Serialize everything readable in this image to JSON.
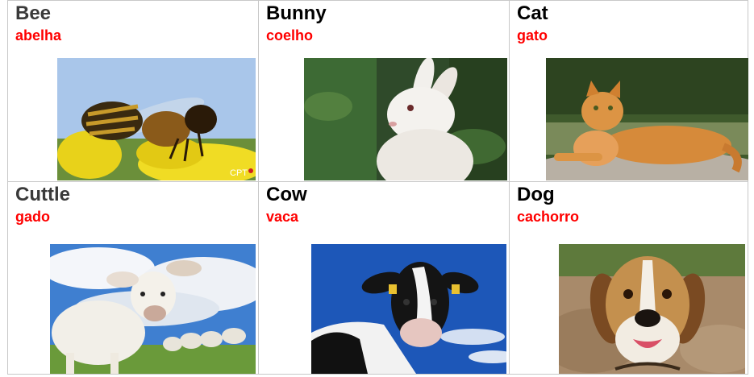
{
  "cards": [
    {
      "english": "Bee",
      "portuguese": "abelha",
      "english_color": "#3a3a3a",
      "image": "bee-photo",
      "watermark": "CPT"
    },
    {
      "english": "Bunny",
      "portuguese": "coelho",
      "english_color": "#000000",
      "image": "bunny-photo"
    },
    {
      "english": "Cat",
      "portuguese": "gato",
      "english_color": "#000000",
      "image": "cat-photo"
    },
    {
      "english": "Cuttle",
      "portuguese": "gado",
      "english_color": "#3a3a3a",
      "image": "cattle-photo"
    },
    {
      "english": "Cow",
      "portuguese": "vaca",
      "english_color": "#000000",
      "image": "cow-photo"
    },
    {
      "english": "Dog",
      "portuguese": "cachorro",
      "english_color": "#000000",
      "image": "dog-photo"
    }
  ],
  "colors": {
    "translation": "#ff0000",
    "border": "#c8c8c8"
  }
}
